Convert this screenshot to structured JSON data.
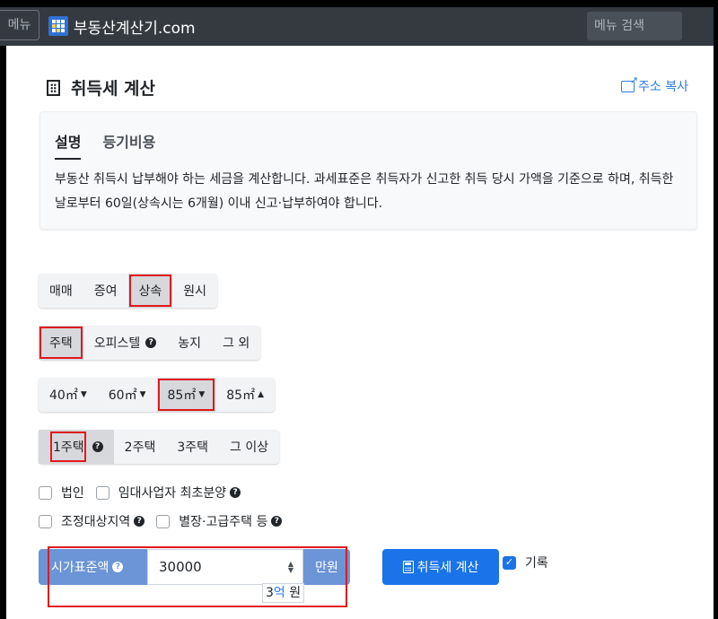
{
  "navbar": {
    "menu_label": "메뉴",
    "brand": "부동산계산기.com",
    "search_placeholder": "메뉴 검색"
  },
  "page": {
    "title": "취득세 계산",
    "copy_link": "주소 복사"
  },
  "info": {
    "tabs": [
      {
        "label": "설명",
        "active": true
      },
      {
        "label": "등기비용",
        "active": false
      }
    ],
    "description": "부동산 취득시 납부해야 하는 세금을 계산합니다. 과세표준은 취득자가 신고한 취득 당시 가액을 기준으로 하며, 취득한 날로부터 60일(상속시는 6개월) 이내 신고·납부하여야 합니다."
  },
  "acquisition_type": {
    "options": [
      "매매",
      "증여",
      "상속",
      "원시"
    ],
    "selected": "상속"
  },
  "property_type": {
    "options": [
      "주택",
      "오피스텔",
      "농지",
      "그 외"
    ],
    "selected": "주택"
  },
  "area": {
    "options": [
      "40㎡",
      "60㎡",
      "85㎡",
      "85㎡"
    ],
    "selected": "85㎡"
  },
  "house_count": {
    "options": [
      "1주택",
      "2주택",
      "3주택",
      "그 이상"
    ],
    "selected": "1주택"
  },
  "checks": {
    "corporation": "법인",
    "rental_business": "임대사업자 최초분양",
    "regulated_area": "조정대상지역",
    "villa_luxury": "별장·고급주택 등"
  },
  "price": {
    "label": "시가표준액",
    "value": "30000",
    "unit": "만원",
    "hint_number": "3",
    "hint_eok": "억",
    "hint_won": "원"
  },
  "actions": {
    "calculate": "취득세 계산",
    "record": "기록",
    "record_checked": true
  }
}
